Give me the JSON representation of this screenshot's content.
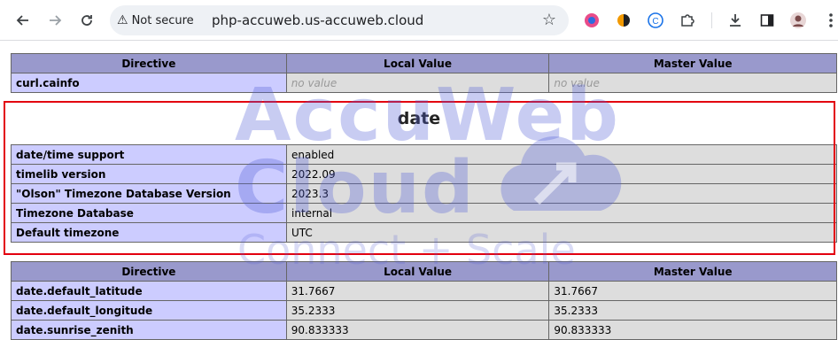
{
  "browser": {
    "security_label": "Not secure",
    "url": "php-accuweb.us-accuweb.cloud"
  },
  "watermark": {
    "line1": "AccuWeb",
    "line2": "Cloud",
    "tagline": "Connect + Scale"
  },
  "table_top": {
    "headers": [
      "Directive",
      "Local Value",
      "Master Value"
    ],
    "row": {
      "directive": "curl.cainfo",
      "local": "no value",
      "master": "no value"
    }
  },
  "date_section": {
    "title": "date",
    "rows": [
      {
        "label": "date/time support",
        "value": "enabled"
      },
      {
        "label": "timelib version",
        "value": "2022.09"
      },
      {
        "label": "\"Olson\" Timezone Database Version",
        "value": "2023.3"
      },
      {
        "label": "Timezone Database",
        "value": "internal"
      },
      {
        "label": "Default timezone",
        "value": "UTC"
      }
    ]
  },
  "table_bottom": {
    "headers": [
      "Directive",
      "Local Value",
      "Master Value"
    ],
    "rows": [
      {
        "directive": "date.default_latitude",
        "local": "31.7667",
        "master": "31.7667"
      },
      {
        "directive": "date.default_longitude",
        "local": "35.2333",
        "master": "35.2333"
      },
      {
        "directive": "date.sunrise_zenith",
        "local": "90.833333",
        "master": "90.833333"
      }
    ]
  },
  "colors": {
    "header_bg": "#9999cc",
    "label_bg": "#ccccff",
    "value_bg": "#dddddd",
    "highlight": "#e3000f"
  }
}
